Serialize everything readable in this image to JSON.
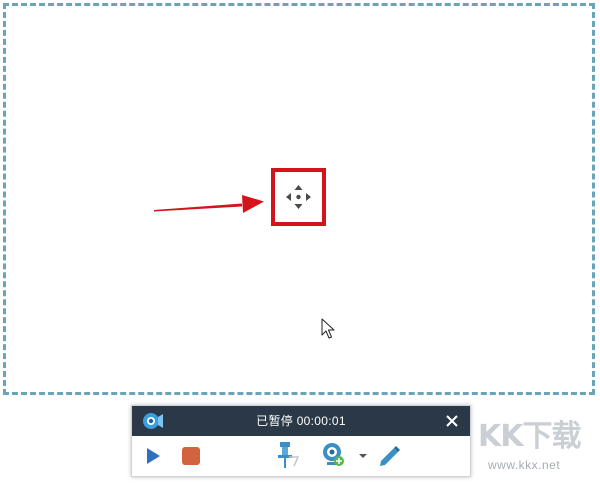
{
  "recording_toolbar": {
    "status_text": "已暂停 00:00:01",
    "buttons": {
      "play": "play-icon",
      "stop": "stop-icon",
      "pin": "pin-icon",
      "webcam": "webcam-icon",
      "webcam_dropdown": "caret-down-icon",
      "pen": "pen-icon",
      "close": "close-icon"
    }
  },
  "capture_region": {
    "move_handle_icon": "move-arrows-icon"
  },
  "watermark": {
    "logo": "KK下载",
    "url": "www.kkx.net"
  },
  "colors": {
    "toolbar_header": "#2a3847",
    "play": "#2f6fbf",
    "stop": "#d1643f",
    "pin": "#3a8fc4",
    "pen": "#3a8fc4",
    "highlight": "#d4141c",
    "region_border": "#6aa4b8"
  }
}
